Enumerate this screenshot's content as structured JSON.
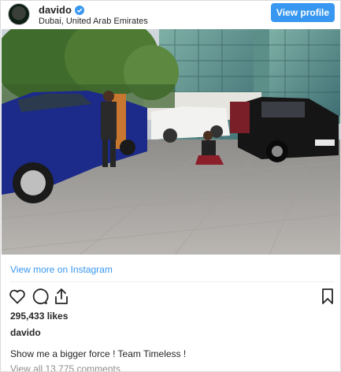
{
  "post": {
    "username": "davido",
    "location": "Dubai, United Arab Emirates",
    "view_profile_label": "View profile",
    "view_more_label": "View more on Instagram",
    "likes": "295,433 likes",
    "caption_username": "davido",
    "caption": "Show me a bigger force ! Team Timeless !",
    "comments_link": "View all 13,775 comments"
  },
  "colors": {
    "accent": "#3897f0",
    "text": "#262626",
    "muted": "#8e8e8e",
    "border": "#dbdbdb"
  },
  "icons": [
    "verified-badge-icon",
    "heart-icon",
    "comment-icon",
    "share-icon",
    "bookmark-icon"
  ]
}
